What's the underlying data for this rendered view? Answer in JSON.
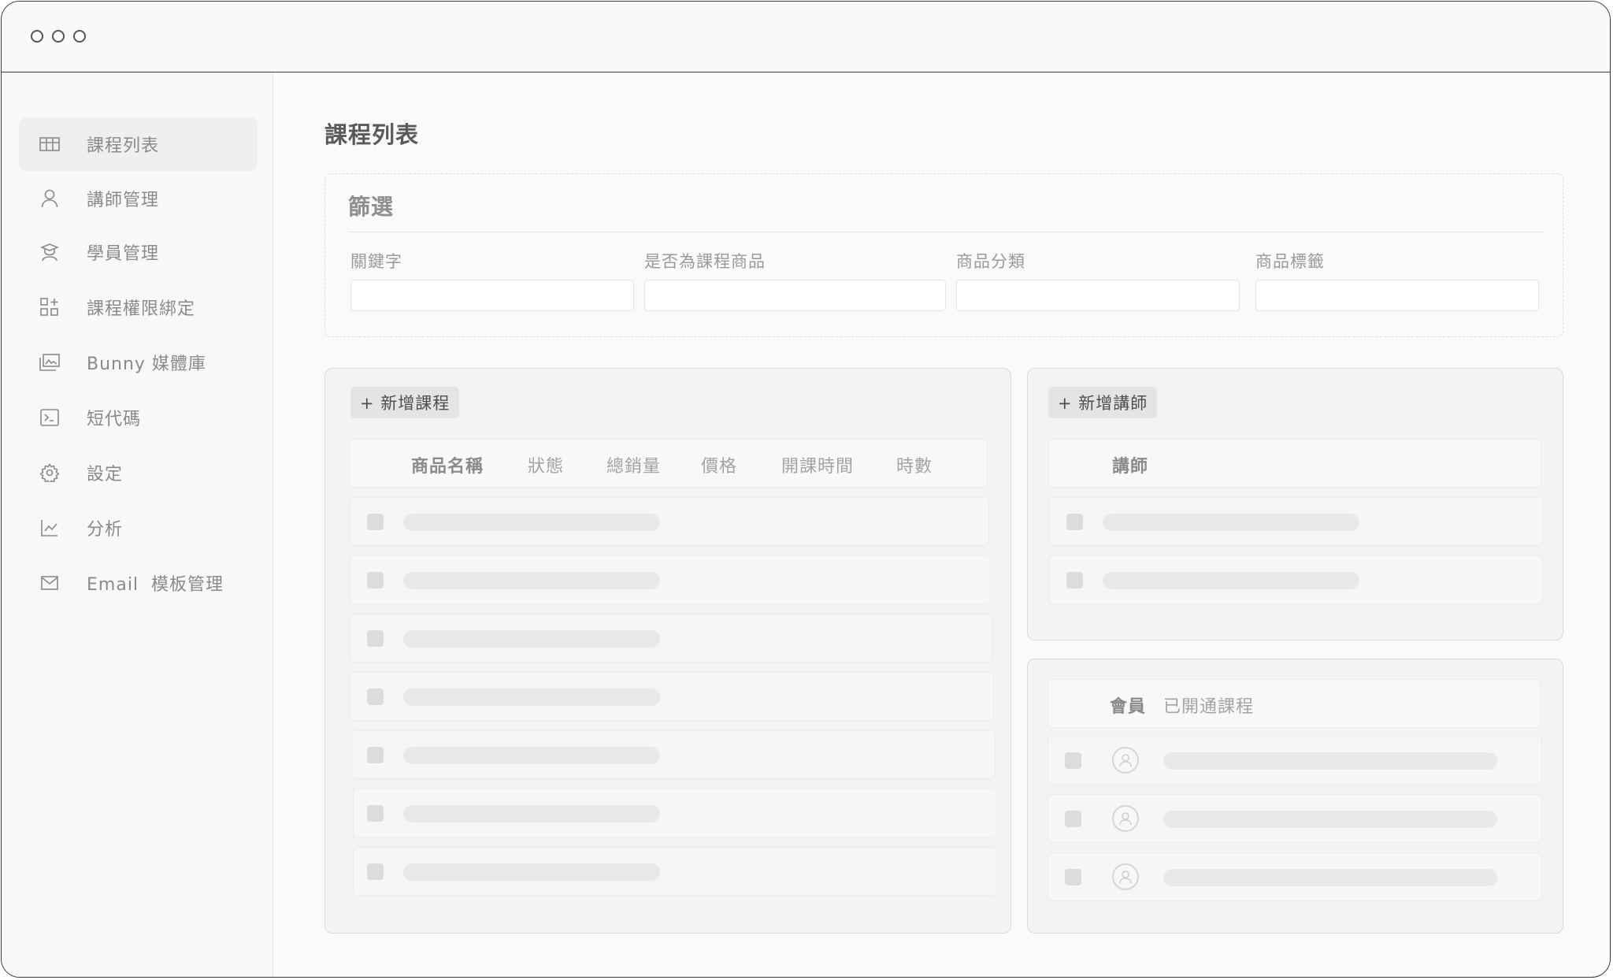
{
  "sidebar": {
    "items": [
      {
        "label": "課程列表",
        "icon": "table-icon",
        "active": true
      },
      {
        "label": "講師管理",
        "icon": "user-icon"
      },
      {
        "label": "學員管理",
        "icon": "graduate-icon"
      },
      {
        "label": "課程權限綁定",
        "icon": "apps-add-icon"
      },
      {
        "label": "Bunny 媒體庫",
        "icon": "media-library-icon"
      },
      {
        "label": "短代碼",
        "icon": "terminal-icon"
      },
      {
        "label": "設定",
        "icon": "gear-icon"
      },
      {
        "label": "分析",
        "icon": "line-chart-icon"
      },
      {
        "label": "Email  模板管理",
        "icon": "mail-icon"
      }
    ]
  },
  "page": {
    "title": "課程列表"
  },
  "filter": {
    "title": "篩選",
    "fields": [
      {
        "label": "關鍵字",
        "value": ""
      },
      {
        "label": "是否為課程商品",
        "value": ""
      },
      {
        "label": "商品分類",
        "value": ""
      },
      {
        "label": "商品標籤",
        "value": ""
      }
    ]
  },
  "courses": {
    "add_label": "+ 新增課程",
    "columns": [
      "商品名稱",
      "狀態",
      "總銷量",
      "價格",
      "開課時間",
      "時數"
    ]
  },
  "teachers": {
    "add_label": "+ 新增講師",
    "columns": [
      "講師"
    ]
  },
  "members": {
    "columns": [
      "會員",
      "已開通課程"
    ]
  }
}
